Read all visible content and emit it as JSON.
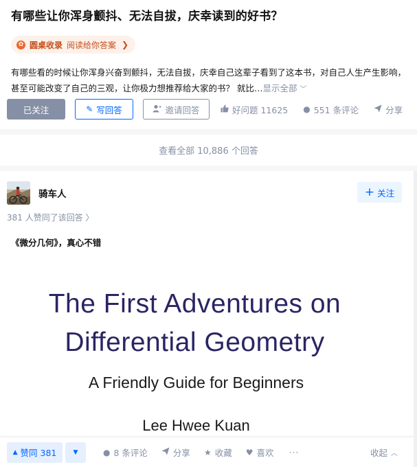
{
  "question": {
    "title": "有哪些让你浑身颤抖、无法自拔，庆幸读到的好书？",
    "roundtable": {
      "name": "圆桌收录",
      "cta": "阅读给你答案",
      "chevron": "❯"
    },
    "description": "有哪些看的时候让你浑身兴奋到颤抖，无法自拔，庆幸自己这辈子看到了这本书，对自己人生产生影响，甚至可能改变了自己的三观，让你极力想推荐给大家的书？ 就比…",
    "show_all": "显示全部",
    "actions": {
      "followed_label": "已关注",
      "write_label": "写回答",
      "invite_label": "邀请回答",
      "good_question_label": "好问题 11625",
      "comments_label": "551 条评论",
      "share_label": "分享",
      "more_label": "···"
    }
  },
  "view_all_answers": "查看全部 10,886 个回答",
  "answer": {
    "author": "骑车人",
    "follow_label": "关注",
    "voters_text": "381 人赞同了该回答 〉",
    "text": "《微分几何》，真心不错",
    "book_cover": {
      "title_line1": "The First Adventures on",
      "title_line2": "Differential Geometry",
      "subtitle": "A Friendly Guide for Beginners",
      "author": "Lee Hwee Kuan"
    },
    "actions": {
      "upvote_label": "赞同 381",
      "comments_label": "8 条评论",
      "share_label": "分享",
      "favorite_label": "收藏",
      "like_label": "喜欢",
      "more_label": "···",
      "collapse_label": "收起"
    }
  },
  "colors": {
    "brand_blue": "#0066ff",
    "muted_gray": "#8590a6",
    "roundtable_orange": "#c34f1c",
    "book_title_navy": "#2a2563"
  }
}
